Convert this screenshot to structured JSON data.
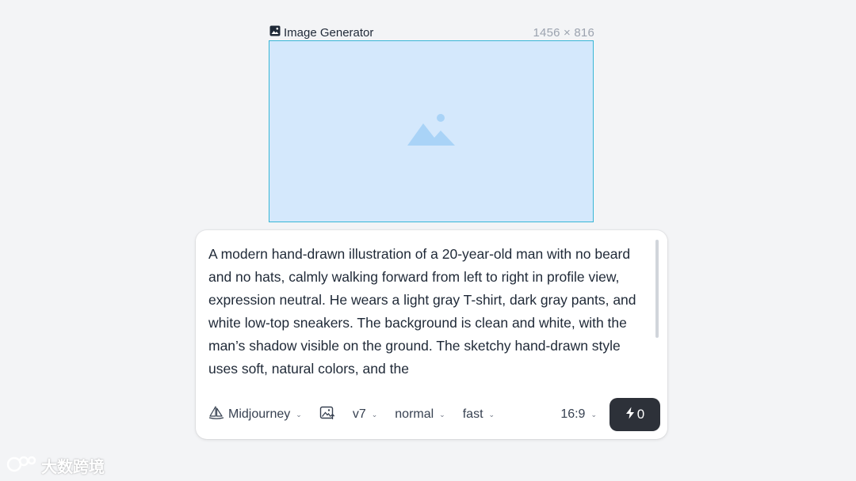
{
  "node": {
    "title": "Image Generator",
    "size_label": "1456 × 816",
    "title_icon": "image-icon",
    "placeholder_icon": "mountain-image-icon"
  },
  "prompt": {
    "text": "A modern hand-drawn illustration of a 20-year-old man with no beard and no hats, calmly walking forward from left to right in profile view, expression neutral. He wears a light gray T-shirt, dark gray pants, and white low-top sneakers. The background is clean and white, with the man’s shadow visible on the ground. The sketchy hand-drawn style uses soft, natural colors, and the"
  },
  "toolbar": {
    "model": "Midjourney",
    "model_icon": "sailboat-icon",
    "image_upload_icon": "image-upload-icon",
    "version": "v7",
    "mode": "normal",
    "speed": "fast",
    "aspect_ratio": "16:9",
    "generate_count": "0",
    "generate_icon": "lightning-icon"
  },
  "watermark": {
    "text": "大数跨境"
  },
  "colors": {
    "canvas_fill": "#d4e8fc",
    "canvas_border": "#38b6d6",
    "button_dark": "#2d3139"
  }
}
